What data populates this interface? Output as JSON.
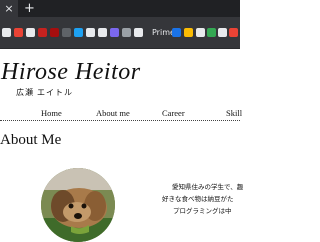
{
  "browser": {
    "tab_icon": "close-icon",
    "tab_glyph": "×",
    "new_tab_glyph": "+",
    "bookmarks": [
      {
        "icon": "bookmark-1-icon",
        "color": "#e8eaed"
      },
      {
        "icon": "bookmark-2-icon",
        "color": "#ea4335"
      },
      {
        "icon": "bookmark-3-icon",
        "color": "#e8eaed"
      },
      {
        "icon": "bookmark-4-icon",
        "color": "#c5221f"
      },
      {
        "icon": "bookmark-5-icon",
        "color": "#a50e0e"
      },
      {
        "icon": "bookmark-6-icon",
        "color": "#5f6368"
      },
      {
        "icon": "bookmark-7-icon",
        "color": "#1da1f2"
      },
      {
        "icon": "bookmark-8-icon",
        "color": "#e8eaed"
      },
      {
        "icon": "bookmark-9-icon",
        "color": "#e8eaed"
      },
      {
        "icon": "bookmark-10-icon",
        "color": "#7b68ee"
      },
      {
        "icon": "bookmark-11-icon",
        "color": "#9aa0a6"
      },
      {
        "icon": "bookmark-12-icon",
        "color": "#e8eaed"
      },
      {
        "icon": "bookmark-13-icon",
        "color": "#1a73e8"
      },
      {
        "icon": "bookmark-14-icon",
        "color": "#fbbc04"
      },
      {
        "icon": "bookmark-15-icon",
        "color": "#e8eaed"
      },
      {
        "icon": "bookmark-16-icon",
        "color": "#34a853"
      },
      {
        "icon": "bookmark-17-icon",
        "color": "#e8eaed"
      },
      {
        "icon": "bookmark-18-icon",
        "color": "#ea4335"
      },
      {
        "icon": "bookmark-19-icon",
        "color": "#e8eaed"
      }
    ],
    "prime_label": "Prime"
  },
  "site": {
    "title": "Hirose Heitor",
    "subtitle": "広瀬 エイトル"
  },
  "nav": [
    "Home",
    "About me",
    "Career",
    "Skill"
  ],
  "about": {
    "heading": "About Me",
    "lines": [
      "愛知県住みの学生で、趣",
      "好きな食べ物は納豆がた",
      "プログラミングは中"
    ]
  }
}
